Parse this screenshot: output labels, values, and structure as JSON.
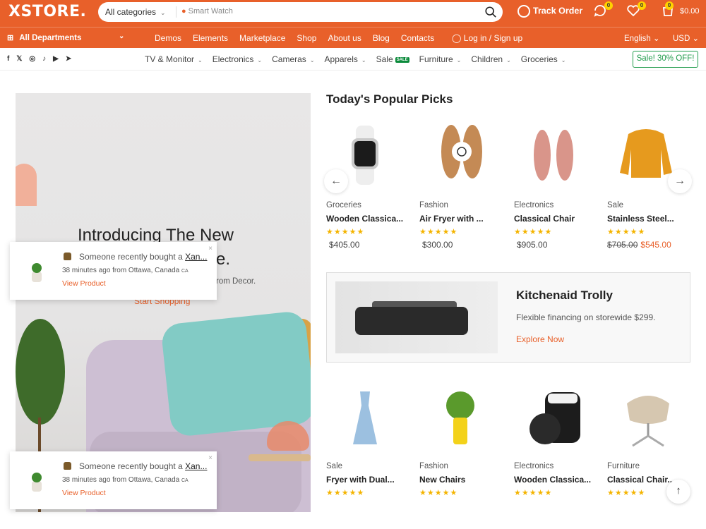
{
  "header": {
    "logo": "XSTORE.",
    "search": {
      "category": "All categories",
      "placeholder": "Smart Watch"
    },
    "track_order": "Track Order",
    "compare_count": "0",
    "wishlist_count": "0",
    "cart_count": "0",
    "cart_amount": "$0.00"
  },
  "nav": {
    "departments": "All Departments",
    "links": [
      "Demos",
      "Elements",
      "Marketplace",
      "Shop",
      "About us",
      "Blog",
      "Contacts"
    ],
    "login": "Log in / Sign up",
    "language": "English",
    "currency": "USD"
  },
  "subnav": {
    "categories": [
      "TV & Monitor",
      "Electronics",
      "Cameras",
      "Apparels",
      "Sale",
      "Furniture",
      "Children",
      "Groceries"
    ],
    "sale_badge": "SALE",
    "promo": "Sale! 30% OFF!"
  },
  "hero": {
    "title_line1": "Introducing The New",
    "title_line2": "re.",
    "subtitle": "rom Decor.",
    "cta": "Start Shopping"
  },
  "toasts": [
    {
      "message": "Someone recently bought a",
      "product": "Xan...",
      "time": "38 minutes ago from Ottawa, Canada",
      "country": "CA",
      "link": "View Product",
      "close": "×"
    },
    {
      "message": "Someone recently bought a",
      "product": "Xan...",
      "time": "38 minutes ago from Ottawa, Canada",
      "country": "CA",
      "link": "View Product",
      "close": "×"
    }
  ],
  "popular": {
    "title": "Today's Popular Picks",
    "products": [
      {
        "category": "Groceries",
        "name": "Wooden Classica...",
        "rating": "★★★★★",
        "price": "$405.00",
        "old_price": ""
      },
      {
        "category": "Fashion",
        "name": "Air Fryer with ...",
        "rating": "★★★★★",
        "price": "$300.00",
        "old_price": ""
      },
      {
        "category": "Electronics",
        "name": "Classical Chair",
        "rating": "★★★★★",
        "price": "$905.00",
        "old_price": ""
      },
      {
        "category": "Sale",
        "name": "Stainless Steel...",
        "rating": "★★★★★",
        "price": "$545.00",
        "old_price": "$705.00"
      }
    ]
  },
  "promo_card": {
    "title": "Kitchenaid Trolly",
    "subtitle": "Flexible financing on storewide $299.",
    "cta": "Explore Now"
  },
  "bottom_products": [
    {
      "category": "Sale",
      "name": "Fryer with Dual...",
      "rating": "★★★★★"
    },
    {
      "category": "Fashion",
      "name": "New Chairs",
      "rating": "★★★★★"
    },
    {
      "category": "Electronics",
      "name": "Wooden Classica...",
      "rating": "★★★★★"
    },
    {
      "category": "Furniture",
      "name": "Classical Chair...",
      "rating": "★★★★★"
    }
  ],
  "icons": {
    "prev": "←",
    "next": "→",
    "up": "↑"
  },
  "colors": {
    "accent": "#e8602a",
    "promo_green": "#1f9b4a",
    "star": "#f4b400"
  }
}
